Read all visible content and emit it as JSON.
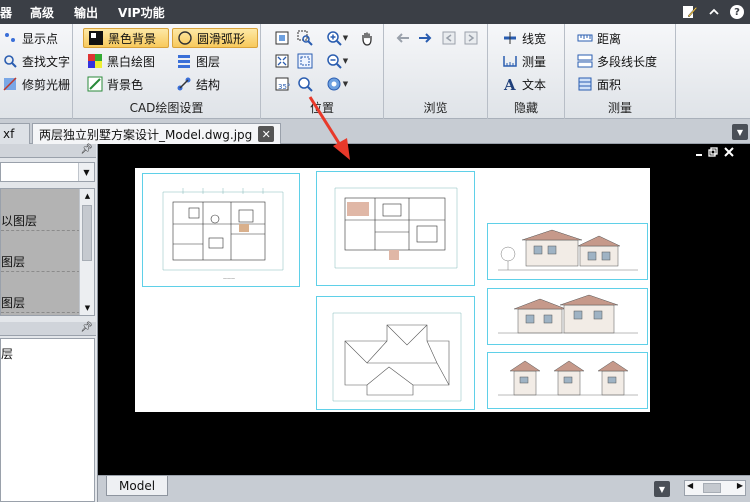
{
  "menu": {
    "items": [
      "高级",
      "输出",
      "VIP功能"
    ],
    "left_fragment": "器"
  },
  "ribbon": {
    "group1": {
      "show_points": "显示点",
      "find_text": "查找文字",
      "trim_raster": "修剪光栅"
    },
    "cad_settings": {
      "label": "CAD绘图设置",
      "black_bg": "黑色背景",
      "smooth_arc": "圆滑弧形",
      "bw_drawing": "黑白绘图",
      "layers": "图层",
      "bg_color": "背景色",
      "structure": "结构"
    },
    "position": {
      "label": "位置"
    },
    "browse": {
      "label": "浏览"
    },
    "hide": {
      "label": "隐藏",
      "line_width": "线宽",
      "measure": "测量",
      "text": "文本"
    },
    "measure": {
      "label": "测量",
      "distance": "距离",
      "polyline_length": "多段线长度",
      "area": "面积"
    }
  },
  "tabs": {
    "prev_fragment": "xf",
    "active_title": "两层独立别墅方案设计_Model.dwg.jpg"
  },
  "left_panel": {
    "layers": [
      "以图层",
      "图层",
      "图层"
    ],
    "props_fragment": "层"
  },
  "bottom": {
    "model_tab": "Model"
  },
  "colors": {
    "menubar": "#3b3f46",
    "active_button": "#f8c95c",
    "canvas": "#000000",
    "frame": "#5fd0e8",
    "arrow": "#e8392a"
  }
}
